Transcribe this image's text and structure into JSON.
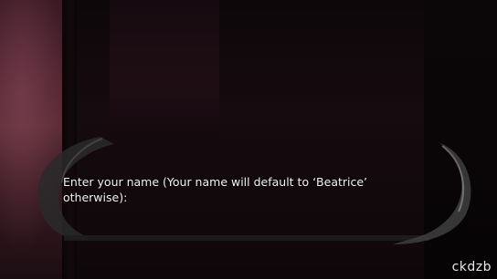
{
  "dialogue": {
    "prompt": "Enter your name (Your name will default to ‘Beatrice’ otherwise):"
  },
  "watermark": {
    "text": "ckdzb"
  },
  "colors": {
    "text": "#f2f2f2",
    "frame": "#4a4a4a",
    "background": "#050304"
  }
}
